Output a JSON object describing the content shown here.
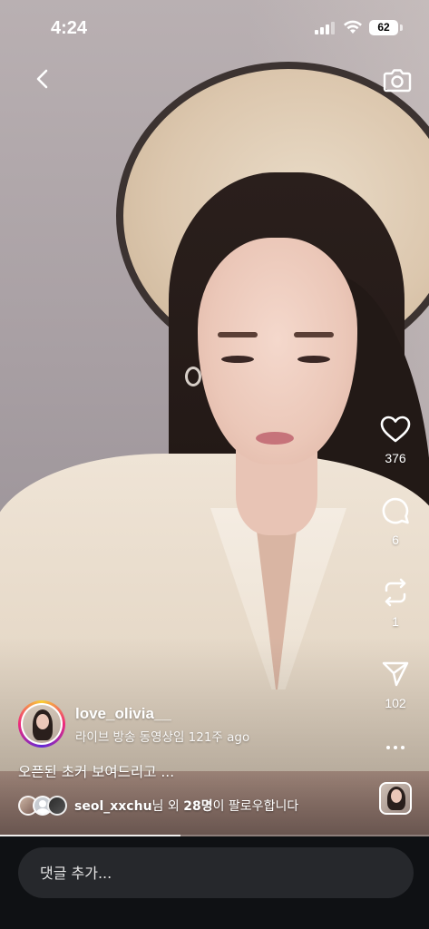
{
  "status_bar": {
    "time": "4:24",
    "battery": "62"
  },
  "top_bar": {
    "back_icon": "chevron-left-icon",
    "camera_icon": "camera-icon"
  },
  "actions": {
    "likes": "376",
    "comments": "6",
    "reposts": "1",
    "shares": "102"
  },
  "creator": {
    "username": "love_olivia__",
    "subline": "라이브 방송 동영상임 121주 ago"
  },
  "caption": "오픈된 초커 보여드리고 ...",
  "followers": {
    "name": "seol_xxchu",
    "suffix1": "님 외 ",
    "count": "28명",
    "suffix2": "이 팔로우합니다"
  },
  "playback": {
    "progress_fraction": 0.42
  },
  "comment_bar": {
    "placeholder": "댓글 추가..."
  },
  "colors": {
    "story_ring": "#ee2a7b",
    "bottom_bar": "#0f1114",
    "input_bg": "#26282c"
  }
}
